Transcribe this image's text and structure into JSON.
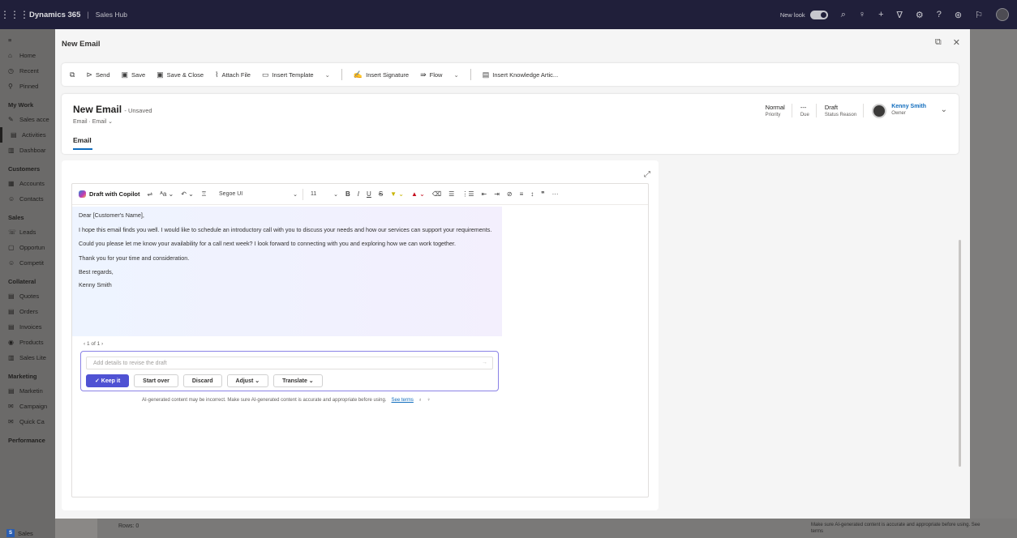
{
  "topbar": {
    "app_name": "Dynamics 365",
    "area": "Sales Hub",
    "new_look": "New look"
  },
  "sidebar": {
    "items_top": [
      {
        "icon": "home-icon",
        "glyph": "⌂",
        "label": "Home"
      },
      {
        "icon": "recent-icon",
        "glyph": "◷",
        "label": "Recent"
      },
      {
        "icon": "pin-icon",
        "glyph": "⚲",
        "label": "Pinned"
      }
    ],
    "groups": [
      {
        "title": "My Work",
        "items": [
          {
            "glyph": "✎",
            "label": "Sales acce"
          },
          {
            "glyph": "▤",
            "label": "Activities"
          },
          {
            "glyph": "▥",
            "label": "Dashboar"
          }
        ]
      },
      {
        "title": "Customers",
        "items": [
          {
            "glyph": "▦",
            "label": "Accounts"
          },
          {
            "glyph": "☺",
            "label": "Contacts"
          }
        ]
      },
      {
        "title": "Sales",
        "items": [
          {
            "glyph": "☏",
            "label": "Leads"
          },
          {
            "glyph": "▢",
            "label": "Opportun"
          },
          {
            "glyph": "☺",
            "label": "Competit"
          }
        ]
      },
      {
        "title": "Collateral",
        "items": [
          {
            "glyph": "▤",
            "label": "Quotes"
          },
          {
            "glyph": "▤",
            "label": "Orders"
          },
          {
            "glyph": "▤",
            "label": "Invoices"
          },
          {
            "glyph": "◉",
            "label": "Products"
          },
          {
            "glyph": "▥",
            "label": "Sales Lite"
          }
        ]
      },
      {
        "title": "Marketing",
        "items": [
          {
            "glyph": "▤",
            "label": "Marketin"
          },
          {
            "glyph": "✉",
            "label": "Campaign"
          },
          {
            "glyph": "✉",
            "label": "Quick Ca"
          }
        ]
      },
      {
        "title": "Performance",
        "items": []
      }
    ],
    "area_switch": {
      "badge": "S",
      "label": "Sales"
    }
  },
  "background": {
    "rows_label": "Rows: 0",
    "note": "Make sure AI-generated content is accurate and appropriate before using. See terms"
  },
  "modal": {
    "title": "New Email",
    "commands": [
      {
        "icon": "send-icon",
        "glyph": "⊳",
        "label": "Send"
      },
      {
        "icon": "save-icon",
        "glyph": "▣",
        "label": "Save"
      },
      {
        "icon": "save-close-icon",
        "glyph": "▣",
        "label": "Save & Close"
      },
      {
        "icon": "attach-icon",
        "glyph": "⌇",
        "label": "Attach File"
      },
      {
        "icon": "template-icon",
        "glyph": "▭",
        "label": "Insert Template"
      },
      {
        "icon": "signature-icon",
        "glyph": "✍",
        "label": "Insert Signature"
      },
      {
        "icon": "flow-icon",
        "glyph": "⇛",
        "label": "Flow"
      },
      {
        "icon": "knowledge-icon",
        "glyph": "▤",
        "label": "Insert Knowledge Artic..."
      }
    ],
    "header": {
      "title": "New Email",
      "state": "- Unsaved",
      "subtitle": "Email · Email ⌄",
      "tab": "Email",
      "fields": [
        {
          "value": "Normal",
          "label": "Priority"
        },
        {
          "value": "---",
          "label": "Due"
        },
        {
          "value": "Draft",
          "label": "Status Reason"
        }
      ],
      "owner": {
        "name": "Kenny Smith",
        "label": "Owner"
      }
    },
    "editor": {
      "copilot_label": "Draft with Copilot",
      "font": "Segoe UI",
      "size": "11",
      "draft": [
        "Dear [Customer's Name],",
        "I hope this email finds you well. I would like to schedule an introductory call with you to discuss your needs and how our services can support your requirements.",
        "Could you please let me know your availability for a call next week? I look forward to connecting with you and exploring how we can work together.",
        "Thank you for your time and consideration.",
        "Best regards,",
        "Kenny Smith"
      ],
      "pager": "‹ 1 of 1 ›",
      "revise_placeholder": "Add details to revise the draft",
      "buttons": {
        "keep": "✓ Keep it",
        "start_over": "Start over",
        "discard": "Discard",
        "adjust": "Adjust ⌄",
        "translate": "Translate ⌄"
      },
      "disclaimer": "AI-generated content may be incorrect. Make sure AI-generated content is accurate and appropriate before using.",
      "see_terms": "See terms"
    }
  }
}
